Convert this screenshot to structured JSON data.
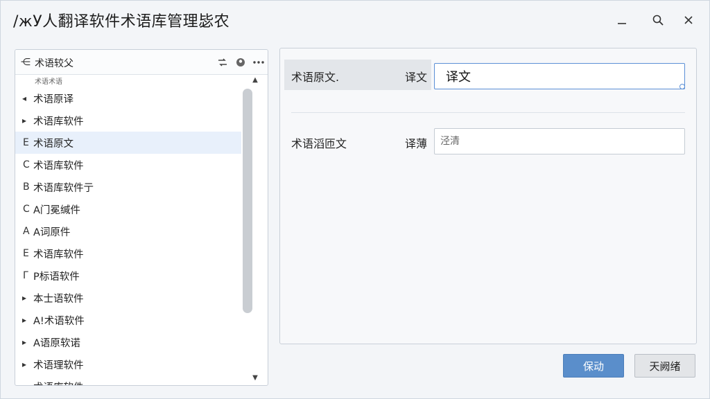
{
  "window": {
    "title": "/жУ人翻译软件术语库管理毖农"
  },
  "left_panel": {
    "back_glyph": "⋲",
    "title": "术语较父",
    "top_note": "术语术语",
    "items": [
      {
        "marker": "◂",
        "label": "术语原译",
        "selected": false
      },
      {
        "marker": "▸",
        "label": "术语库软件",
        "selected": false
      },
      {
        "marker": "E",
        "label": "术语原文",
        "selected": true
      },
      {
        "marker": "C",
        "label": "术语库软件",
        "selected": false
      },
      {
        "marker": "B",
        "label": "术语库软件亍",
        "selected": false
      },
      {
        "marker": "C",
        "label": "A门冕缄件",
        "selected": false
      },
      {
        "marker": "A",
        "label": "A词原件",
        "selected": false
      },
      {
        "marker": "E",
        "label": "术语库软件",
        "selected": false
      },
      {
        "marker": "Γ",
        "label": "P标语软件",
        "selected": false
      },
      {
        "marker": "▸",
        "label": "本士语软件",
        "selected": false
      },
      {
        "marker": "▸",
        "label": "A!术语软件",
        "selected": false
      },
      {
        "marker": "▸",
        "label": "A语原软诺",
        "selected": false
      },
      {
        "marker": "▸",
        "label": "术语理软件",
        "selected": false
      },
      {
        "marker": "",
        "label": "术语库软件",
        "selected": false
      }
    ]
  },
  "right_panel": {
    "row1": {
      "label": "术语原文.",
      "trans_label": "译文",
      "value": "译文"
    },
    "row2": {
      "label": "术语滔匝文",
      "trans_label": "译薄",
      "placeholder": "泾清"
    }
  },
  "buttons": {
    "save": "保动",
    "cancel": "天阙绪"
  },
  "colors": {
    "accent": "#5a8ecb",
    "selected_row": "#e8f0fb",
    "focus_border": "#5b8fd6"
  }
}
